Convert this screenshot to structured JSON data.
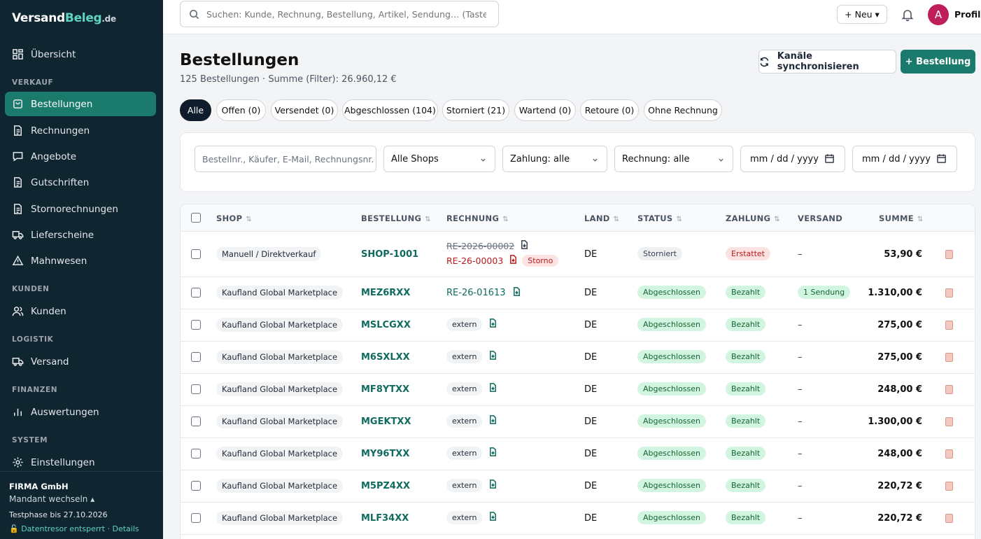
{
  "brand": {
    "part1": "Versand",
    "part2": "Beleg",
    "tld": ".de"
  },
  "sidebar": {
    "overview": "Übersicht",
    "sections": {
      "verkauf": "VERKAUF",
      "kunden": "KUNDEN",
      "logistik": "LOGISTIK",
      "finanzen": "FINANZEN",
      "system": "SYSTEM"
    },
    "items": {
      "bestellungen": "Bestellungen",
      "rechnungen": "Rechnungen",
      "angebote": "Angebote",
      "gutschriften": "Gutschriften",
      "stornorechnungen": "Stornorechnungen",
      "lieferscheine": "Lieferscheine",
      "mahnwesen": "Mahnwesen",
      "kunden": "Kunden",
      "versand": "Versand",
      "auswertungen": "Auswertungen",
      "einstellungen": "Einstellungen"
    },
    "footer": {
      "company": "FIRMA GmbH",
      "switch": "Mandant wechseln ▴",
      "trial": "Testphase bis 27.10.2026",
      "vault": "🔓 Datentresor entsperrt · Details"
    }
  },
  "topbar": {
    "search_placeholder": "Suchen: Kunde, Rechnung, Bestellung, Artikel, Sendung… (Taste /)",
    "new_label": "+ Neu ▾",
    "avatar_letter": "A",
    "profile_label": "Profil"
  },
  "page": {
    "title": "Bestellungen",
    "subtitle": "125 Bestellungen · Summe (Filter): 26.960,12 €",
    "sync_label": "Kanäle synchronisieren",
    "new_order_label": "+ Bestellung"
  },
  "tabs": [
    "Alle",
    "Offen (0)",
    "Versendet (0)",
    "Abgeschlossen (104)",
    "Storniert (21)",
    "Wartend (0)",
    "Retoure (0)",
    "Ohne Rechnung"
  ],
  "filters": {
    "search_placeholder": "Bestellnr., Käufer, E-Mail, Rechnungsnr.",
    "shop": "Alle Shops",
    "payment": "Zahlung: alle",
    "invoice": "Rechnung: alle",
    "date_from": "mm / dd / yyyy",
    "date_to": "mm / dd / yyyy"
  },
  "table": {
    "headers": {
      "shop": "SHOP",
      "order": "BESTELLUNG",
      "invoice": "RECHNUNG",
      "country": "LAND",
      "status": "STATUS",
      "payment": "ZAHLUNG",
      "shipping": "VERSAND",
      "sum": "SUMME",
      "sort": "⇅"
    },
    "first_row": {
      "shop": "Manuell / Direktverkauf",
      "order": "SHOP-1001",
      "invoice_old": "RE-2026-00002",
      "invoice_storno": "RE-26-00003",
      "storno_label": "Storno",
      "country": "DE",
      "status": "Storniert",
      "payment": "Erstattet",
      "shipping": "–",
      "sum": "53,90 €"
    },
    "second_row": {
      "shop": "Kaufland Global Marketplace",
      "order": "MEZ6RXX",
      "invoice": "RE-26-01613",
      "country": "DE",
      "status": "Abgeschlossen",
      "payment": "Bezahlt",
      "shipping": "1 Sendung",
      "sum": "1.310,00 €"
    },
    "rows": [
      {
        "shop": "Kaufland Global Marketplace",
        "order": "MSLCGXX",
        "invoice": "extern",
        "country": "DE",
        "status": "Abgeschlossen",
        "payment": "Bezahlt",
        "shipping": "–",
        "sum": "275,00 €"
      },
      {
        "shop": "Kaufland Global Marketplace",
        "order": "M6SXLXX",
        "invoice": "extern",
        "country": "DE",
        "status": "Abgeschlossen",
        "payment": "Bezahlt",
        "shipping": "–",
        "sum": "275,00 €"
      },
      {
        "shop": "Kaufland Global Marketplace",
        "order": "MF8YTXX",
        "invoice": "extern",
        "country": "DE",
        "status": "Abgeschlossen",
        "payment": "Bezahlt",
        "shipping": "–",
        "sum": "248,00 €"
      },
      {
        "shop": "Kaufland Global Marketplace",
        "order": "MGEKTXX",
        "invoice": "extern",
        "country": "DE",
        "status": "Abgeschlossen",
        "payment": "Bezahlt",
        "shipping": "–",
        "sum": "1.300,00 €"
      },
      {
        "shop": "Kaufland Global Marketplace",
        "order": "MY96TXX",
        "invoice": "extern",
        "country": "DE",
        "status": "Abgeschlossen",
        "payment": "Bezahlt",
        "shipping": "–",
        "sum": "248,00 €"
      },
      {
        "shop": "Kaufland Global Marketplace",
        "order": "M5PZ4XX",
        "invoice": "extern",
        "country": "DE",
        "status": "Abgeschlossen",
        "payment": "Bezahlt",
        "shipping": "–",
        "sum": "220,72 €"
      },
      {
        "shop": "Kaufland Global Marketplace",
        "order": "MLF34XX",
        "invoice": "extern",
        "country": "DE",
        "status": "Abgeschlossen",
        "payment": "Bezahlt",
        "shipping": "–",
        "sum": "220,72 €"
      }
    ]
  },
  "colors": {
    "accent": "#1a7a6c",
    "sidebar": "#0f2530",
    "tab_active": "#0f1c2b"
  }
}
